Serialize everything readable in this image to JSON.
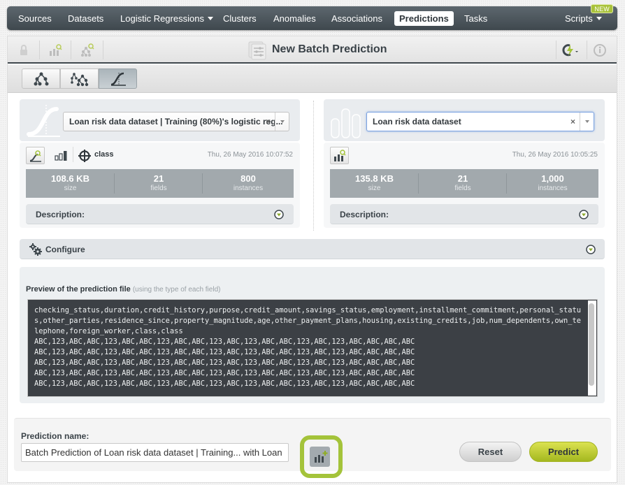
{
  "nav": {
    "items": [
      {
        "label": "Sources"
      },
      {
        "label": "Datasets"
      },
      {
        "label": "Logistic Regressions",
        "dropdown": true
      },
      {
        "label": "Clusters"
      },
      {
        "label": "Anomalies"
      },
      {
        "label": "Associations"
      },
      {
        "label": "Predictions",
        "active": true
      },
      {
        "label": "Tasks"
      }
    ],
    "scripts_label": "Scripts",
    "new_badge": "NEW"
  },
  "toolbar": {
    "title": "New Batch Prediction",
    "icons": [
      "lock-icon",
      "dataset-search-icon",
      "model-search-icon",
      "lightning-refresh-icon",
      "info-icon"
    ]
  },
  "model_tabs": [
    {
      "name": "decision-tree-tab",
      "icon": "tree-icon"
    },
    {
      "name": "ensemble-tab",
      "icon": "ensemble-icon"
    },
    {
      "name": "logistic-regression-tab",
      "icon": "logistic-curve-icon",
      "active": true
    }
  ],
  "model_panel": {
    "selected": "Loan risk data dataset | Training (80%)'s logistic reg...",
    "clear": "×",
    "objective_field": "class",
    "date": "Thu, 26 May 2016 10:07:52",
    "stats": [
      {
        "value": "108.6 KB",
        "label": "size"
      },
      {
        "value": "21",
        "label": "fields"
      },
      {
        "value": "800",
        "label": "instances"
      }
    ],
    "description_label": "Description:"
  },
  "dataset_panel": {
    "selected": "Loan risk data dataset",
    "clear": "×",
    "date": "Thu, 26 May 2016 10:05:25",
    "stats": [
      {
        "value": "135.8 KB",
        "label": "size"
      },
      {
        "value": "21",
        "label": "fields"
      },
      {
        "value": "1,000",
        "label": "instances"
      }
    ],
    "description_label": "Description:"
  },
  "configure": {
    "label": "Configure"
  },
  "preview": {
    "title": "Preview of the prediction file",
    "hint": "(using the type of each field)",
    "content": "checking_status,duration,credit_history,purpose,credit_amount,savings_status,employment,installment_commitment,personal_status,other_parties,residence_since,property_magnitude,age,other_payment_plans,housing,existing_credits,job,num_dependents,own_telephone,foreign_worker,class,class\nABC,123,ABC,ABC,123,ABC,ABC,123,ABC,ABC,123,ABC,123,ABC,ABC,123,ABC,123,ABC,ABC,ABC,ABC\nABC,123,ABC,ABC,123,ABC,ABC,123,ABC,ABC,123,ABC,123,ABC,ABC,123,ABC,123,ABC,ABC,ABC,ABC\nABC,123,ABC,ABC,123,ABC,ABC,123,ABC,ABC,123,ABC,123,ABC,ABC,123,ABC,123,ABC,ABC,ABC,ABC\nABC,123,ABC,ABC,123,ABC,ABC,123,ABC,ABC,123,ABC,123,ABC,ABC,123,ABC,123,ABC,ABC,ABC,ABC\nABC,123,ABC,ABC,123,ABC,ABC,123,ABC,ABC,123,ABC,123,ABC,ABC,123,ABC,123,ABC,ABC,ABC,ABC"
  },
  "bottom": {
    "prediction_name_label": "Prediction name:",
    "prediction_name_value": "Batch Prediction of Loan risk data dataset | Training... with Loan",
    "reset_label": "Reset",
    "predict_label": "Predict"
  },
  "colors": {
    "accent": "#a4c33a",
    "nav_bg": "#4a535a",
    "predict_button": "#c5d033"
  }
}
